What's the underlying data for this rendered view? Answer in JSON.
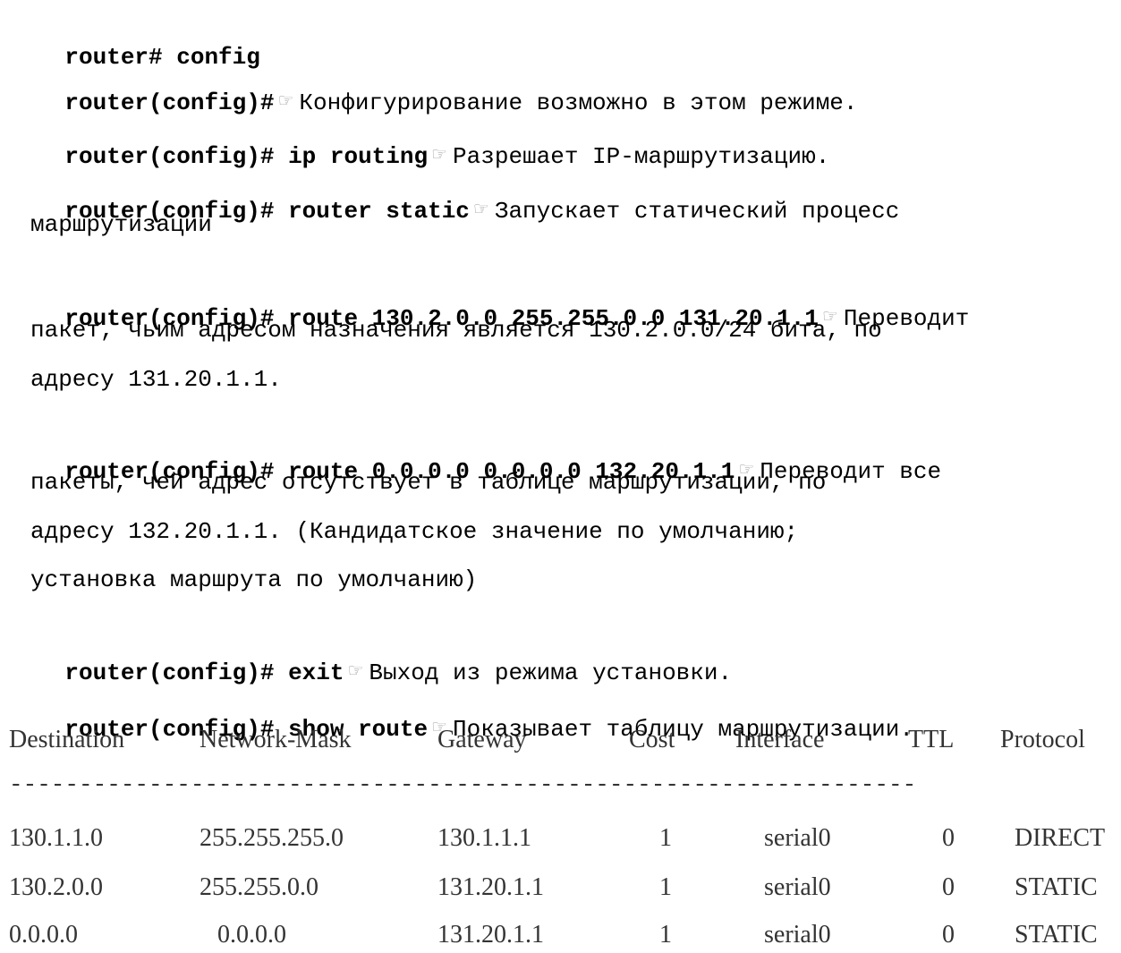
{
  "session": [
    {
      "cmd": "router# config",
      "desc": ""
    },
    {
      "cmd": "router(config)#",
      "desc": "Конфигурирование возможно в этом режиме."
    },
    {
      "cmd": "router(config)# ip routing",
      "desc": "Разрешает IP-маршрутизацию."
    },
    {
      "cmd": "router(config)# router static",
      "desc": "Запускает статический процесс",
      "cont": [
        "маршрутизации"
      ]
    },
    {
      "cmd": "router(config)# route 130.2.0.0 255.255.0.0 131.20.1.1",
      "desc": "Переводит",
      "cont": [
        "пакет, чьим адресом назначения является 130.2.0.0/24 бита, по",
        "адресу 131.20.1.1."
      ]
    },
    {
      "cmd": "router(config)# route 0.0.0.0 0.0.0.0 132.20.1.1",
      "desc": "Переводит все",
      "cont": [
        "пакеты, чей адрес отсутствует в таблице маршрутизации, по",
        "адресу 132.20.1.1. (Кандидатское значение по умолчанию;",
        "установка маршрута по умолчанию)"
      ]
    },
    {
      "cmd": "router(config)# exit",
      "desc": "Выход из режима установки."
    },
    {
      "cmd": "router(config)# show route",
      "desc": "Показывает таблицу маршрутизации."
    }
  ],
  "hand_icon": "pointing-hand-icon",
  "hand_glyph": "☞",
  "route_table": {
    "headers": [
      "Destination",
      "Network-Mask",
      "Gateway",
      "Cost",
      "Interface",
      "TTL",
      "Protocol"
    ],
    "separator": "-----------------------------------------------------------------",
    "rows": [
      [
        "130.1.1.0",
        "255.255.255.0",
        "130.1.1.1",
        "1",
        "serial0",
        "0",
        "DIRECT"
      ],
      [
        "130.2.0.0",
        "255.255.0.0",
        "131.20.1.1",
        "1",
        "serial0",
        "0",
        "STATIC"
      ],
      [
        "0.0.0.0",
        "0.0.0.0",
        "131.20.1.1",
        "1",
        "serial0",
        "0",
        "STATIC"
      ]
    ]
  }
}
